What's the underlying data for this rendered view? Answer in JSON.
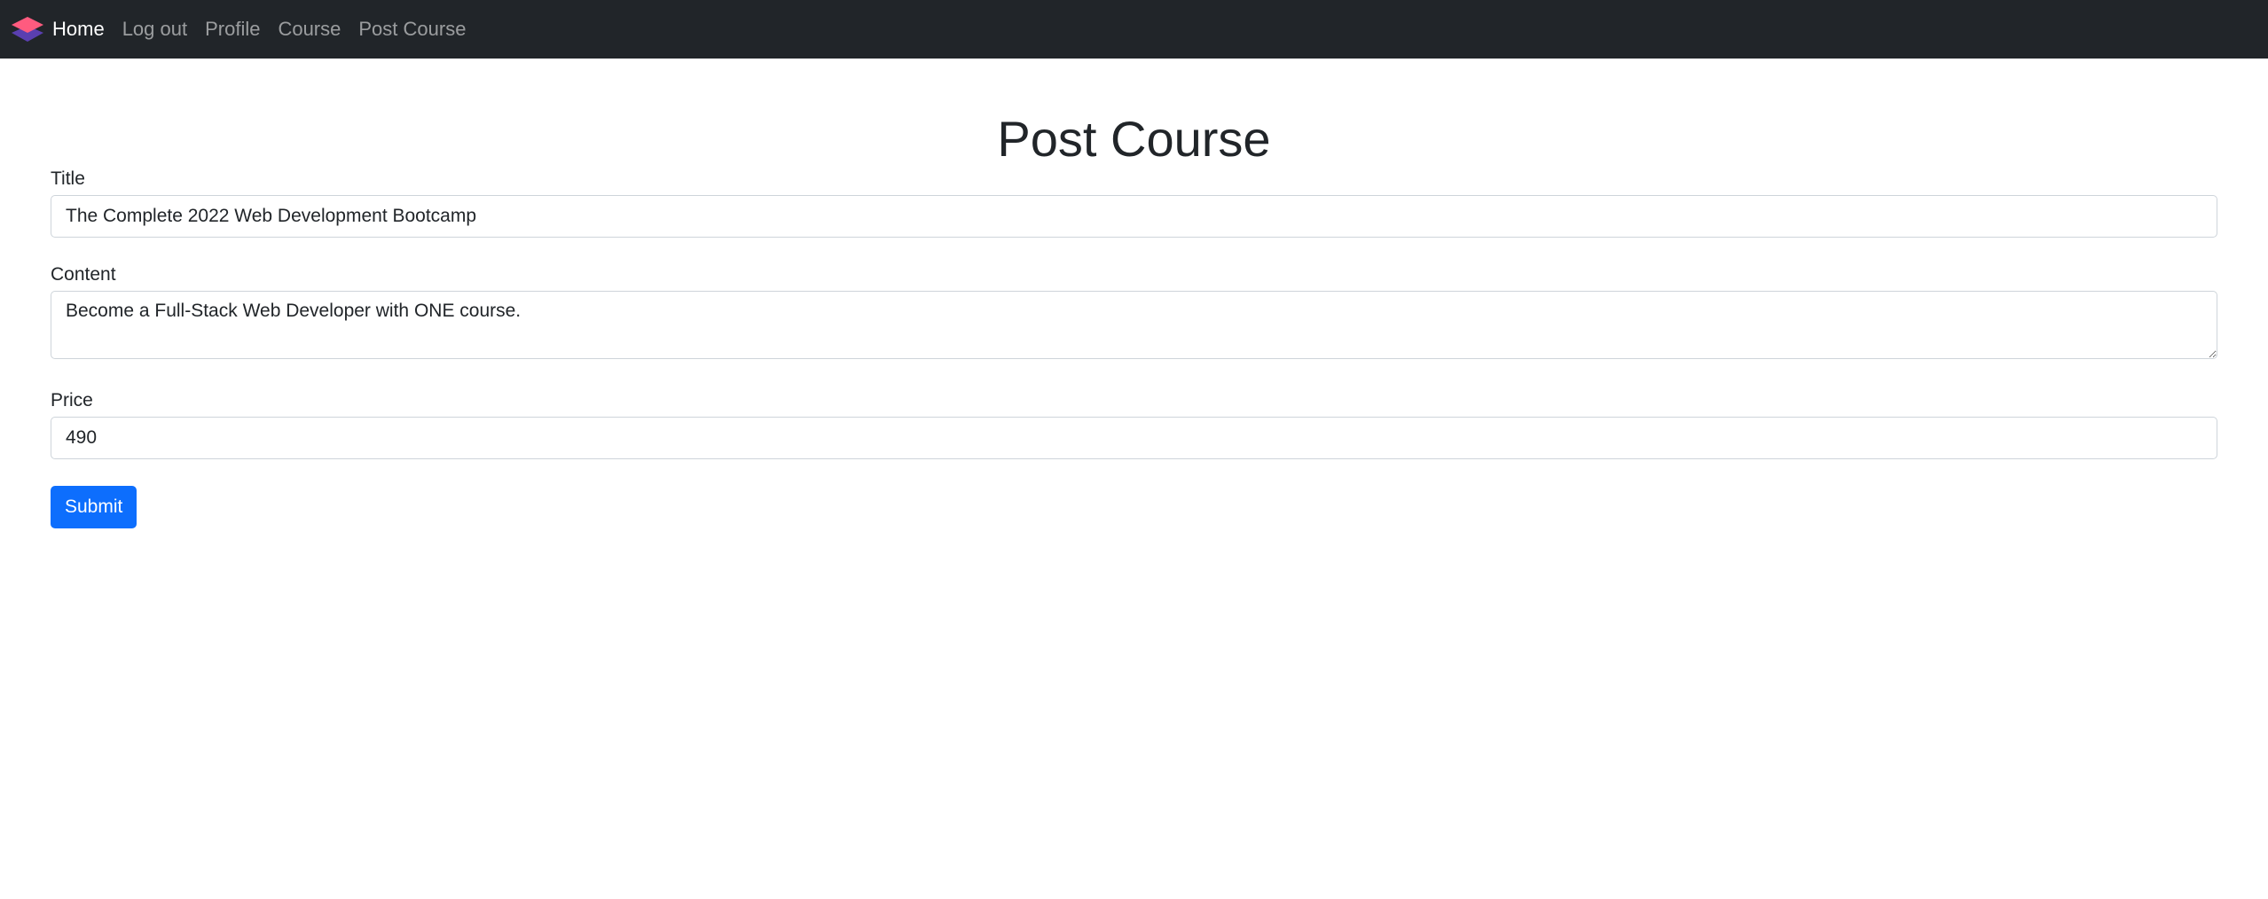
{
  "nav": {
    "items": [
      {
        "label": "Home"
      },
      {
        "label": "Log out"
      },
      {
        "label": "Profile"
      },
      {
        "label": "Course"
      },
      {
        "label": "Post Course"
      }
    ],
    "logo_icon": "layered-diamond-icon",
    "logo_colors": {
      "top": "#ff5b7f",
      "bottom": "#5a3fb0"
    }
  },
  "page": {
    "title": "Post Course"
  },
  "form": {
    "title_label": "Title",
    "title_value": "The Complete 2022 Web Development Bootcamp",
    "content_label": "Content",
    "content_value": "Become a Full-Stack Web Developer with ONE course.",
    "price_label": "Price",
    "price_value": "490",
    "submit_label": "Submit"
  }
}
